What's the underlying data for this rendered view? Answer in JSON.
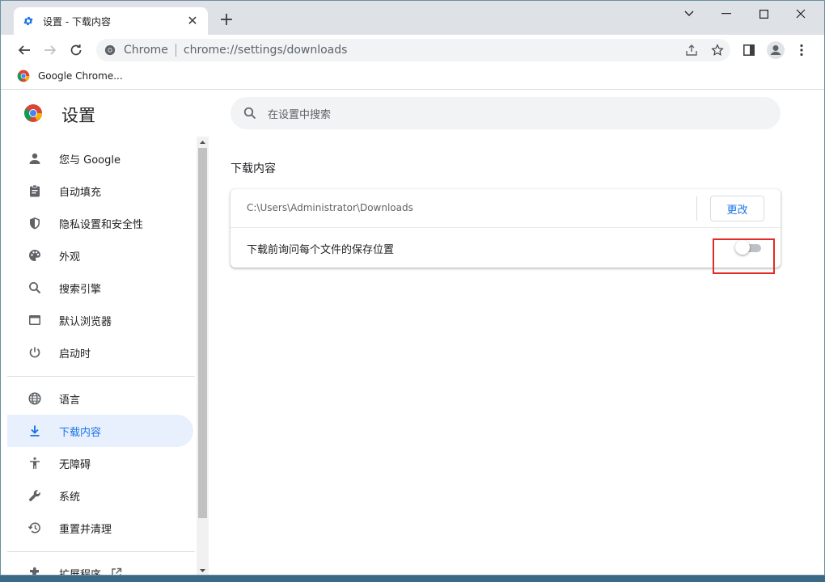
{
  "browser": {
    "tab": {
      "title": "设置 - 下载内容"
    },
    "omnibox": {
      "site_label": "Chrome",
      "url": "chrome://settings/downloads"
    },
    "bookmarks": [
      {
        "label": "Google Chrome..."
      }
    ]
  },
  "settings": {
    "title": "设置",
    "search": {
      "placeholder": "在设置中搜索"
    },
    "sidebar": {
      "items": [
        {
          "label": "您与 Google",
          "icon": "person-icon"
        },
        {
          "label": "自动填充",
          "icon": "clipboard-icon"
        },
        {
          "label": "隐私设置和安全性",
          "icon": "shield-icon"
        },
        {
          "label": "外观",
          "icon": "palette-icon"
        },
        {
          "label": "搜索引擎",
          "icon": "search-icon"
        },
        {
          "label": "默认浏览器",
          "icon": "browser-window-icon"
        },
        {
          "label": "启动时",
          "icon": "power-icon"
        },
        {
          "label": "语言",
          "icon": "globe-icon"
        },
        {
          "label": "下载内容",
          "icon": "download-icon",
          "active": true
        },
        {
          "label": "无障碍",
          "icon": "accessibility-icon"
        },
        {
          "label": "系统",
          "icon": "wrench-icon"
        },
        {
          "label": "重置并清理",
          "icon": "restore-icon"
        },
        {
          "label": "扩展程序",
          "icon": "puzzle-icon"
        }
      ]
    },
    "downloads": {
      "section_title": "下载内容",
      "location_path": "C:\\Users\\Administrator\\Downloads",
      "change_label": "更改",
      "ask_label": "下载前询问每个文件的保存位置",
      "ask_enabled": false
    }
  },
  "colors": {
    "accent": "#1a73e8",
    "highlight": "#e02b2b",
    "active_bg": "#e8f0fe"
  }
}
